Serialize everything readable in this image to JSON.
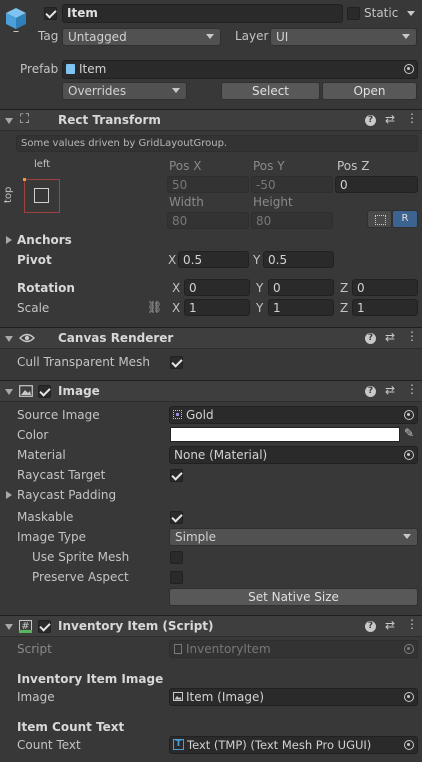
{
  "header": {
    "name": "Item",
    "static_label": "Static",
    "tag_label": "Tag",
    "tag_value": "Untagged",
    "layer_label": "Layer",
    "layer_value": "UI",
    "prefab_label": "Prefab",
    "prefab_value": "Item",
    "overrides_label": "Overrides",
    "select_label": "Select",
    "open_label": "Open"
  },
  "rect_transform": {
    "title": "Rect Transform",
    "notice": "Some values driven by GridLayoutGroup.",
    "anchor_left": "left",
    "anchor_top": "top",
    "pos_x_label": "Pos X",
    "pos_y_label": "Pos Y",
    "pos_z_label": "Pos Z",
    "pos_x": "50",
    "pos_y": "-50",
    "pos_z": "0",
    "width_label": "Width",
    "height_label": "Height",
    "width": "80",
    "height": "80",
    "r_button": "R",
    "anchors_label": "Anchors",
    "pivot_label": "Pivot",
    "pivot_x": "0.5",
    "pivot_y": "0.5",
    "rotation_label": "Rotation",
    "rotation": {
      "x": "0",
      "y": "0",
      "z": "0"
    },
    "scale_label": "Scale",
    "scale": {
      "x": "1",
      "y": "1",
      "z": "1"
    },
    "axis_x": "X",
    "axis_y": "Y",
    "axis_z": "Z"
  },
  "canvas_renderer": {
    "title": "Canvas Renderer",
    "cull_label": "Cull Transparent Mesh",
    "cull_checked": true
  },
  "image": {
    "title": "Image",
    "source_image_label": "Source Image",
    "source_image_value": "Gold",
    "color_label": "Color",
    "color_value": "#ffffff",
    "material_label": "Material",
    "material_value": "None (Material)",
    "raycast_target_label": "Raycast Target",
    "raycast_padding_label": "Raycast Padding",
    "maskable_label": "Maskable",
    "image_type_label": "Image Type",
    "image_type_value": "Simple",
    "use_sprite_mesh_label": "Use Sprite Mesh",
    "preserve_aspect_label": "Preserve Aspect",
    "set_native_size_label": "Set Native Size"
  },
  "inventory_item": {
    "title": "Inventory Item (Script)",
    "script_label": "Script",
    "script_value": "InventoryItem",
    "section1_header": "Inventory Item Image",
    "image_label": "Image",
    "image_value": "Item (Image)",
    "section2_header": "Item Count Text",
    "count_text_label": "Count Text",
    "count_text_value": "Text (TMP) (Text Mesh Pro UGUI)"
  }
}
